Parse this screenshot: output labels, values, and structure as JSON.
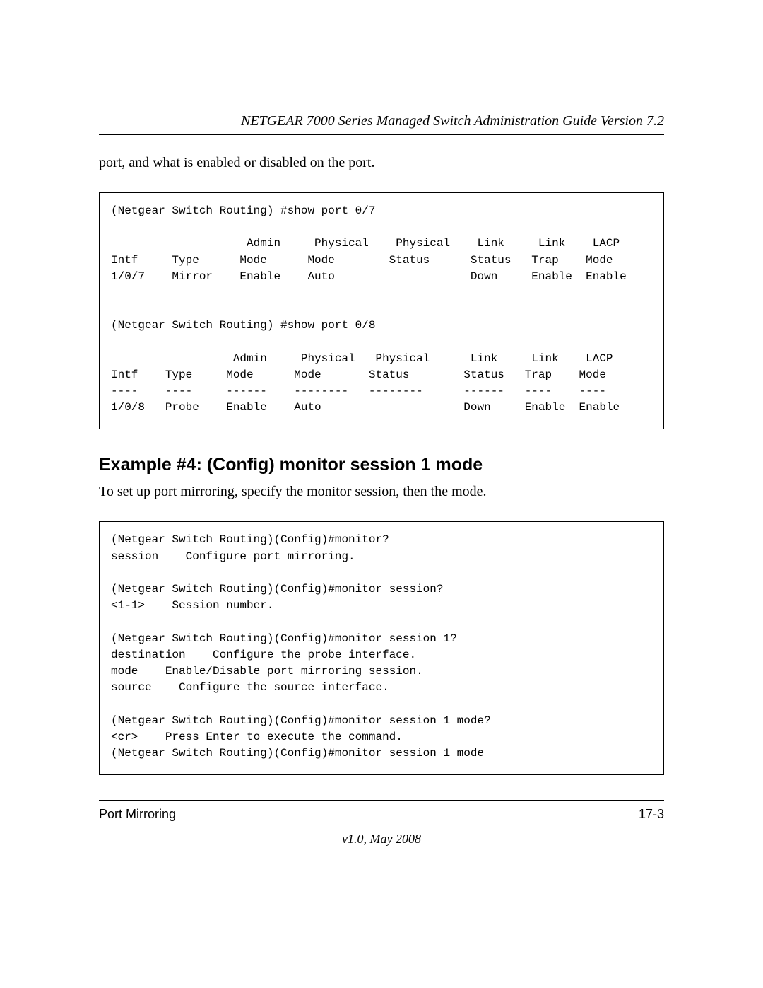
{
  "header": {
    "running_title": "NETGEAR 7000 Series Managed Switch Administration Guide Version 7.2"
  },
  "body": {
    "intro_line": "port, and what is enabled or disabled on the port.",
    "code_block_1": "(Netgear Switch Routing) #show port 0/7\n\n                    Admin     Physical    Physical    Link     Link    LACP\nIntf     Type      Mode      Mode        Status      Status   Trap    Mode\n1/0/7    Mirror    Enable    Auto                    Down     Enable  Enable\n\n\n(Netgear Switch Routing) #show port 0/8\n\n                  Admin     Physical   Physical      Link     Link    LACP\nIntf    Type     Mode      Mode       Status        Status   Trap    Mode\n----    ----     ------    --------   --------      ------   ----    ----\n1/0/8   Probe    Enable    Auto                     Down     Enable  Enable",
    "example4_heading": "Example #4: (Config) monitor session 1 mode",
    "example4_text": "To set up port mirroring, specify the monitor session, then the mode.",
    "code_block_2": "(Netgear Switch Routing)(Config)#monitor?\nsession    Configure port mirroring.\n\n(Netgear Switch Routing)(Config)#monitor session?\n<1-1>    Session number.\n\n(Netgear Switch Routing)(Config)#monitor session 1?\ndestination    Configure the probe interface.\nmode    Enable/Disable port mirroring session.\nsource    Configure the source interface.\n\n(Netgear Switch Routing)(Config)#monitor session 1 mode?\n<cr>    Press Enter to execute the command.\n(Netgear Switch Routing)(Config)#monitor session 1 mode"
  },
  "footer": {
    "section": "Port Mirroring",
    "page_number": "17-3",
    "version": "v1.0, May 2008"
  }
}
